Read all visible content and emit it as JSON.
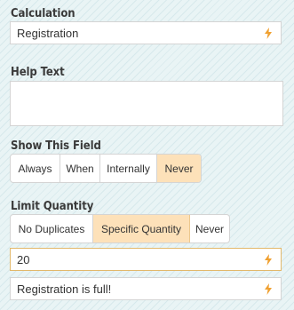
{
  "calculation": {
    "label": "Calculation",
    "value": "Registration"
  },
  "help_text": {
    "label": "Help Text",
    "value": ""
  },
  "show_field": {
    "label": "Show This Field",
    "options": [
      "Always",
      "When",
      "Internally",
      "Never"
    ],
    "selected": "Never"
  },
  "limit_quantity": {
    "label": "Limit Quantity",
    "options": [
      "No Duplicates",
      "Specific Quantity",
      "Never"
    ],
    "selected": "Specific Quantity",
    "quantity_value": "20",
    "full_message": "Registration is full!"
  },
  "colors": {
    "accent": "#f0a030",
    "selected_bg": "#fde1b9",
    "active_border": "#e2b86b"
  },
  "icons": {
    "field_action": "lightning-bolt-icon"
  }
}
